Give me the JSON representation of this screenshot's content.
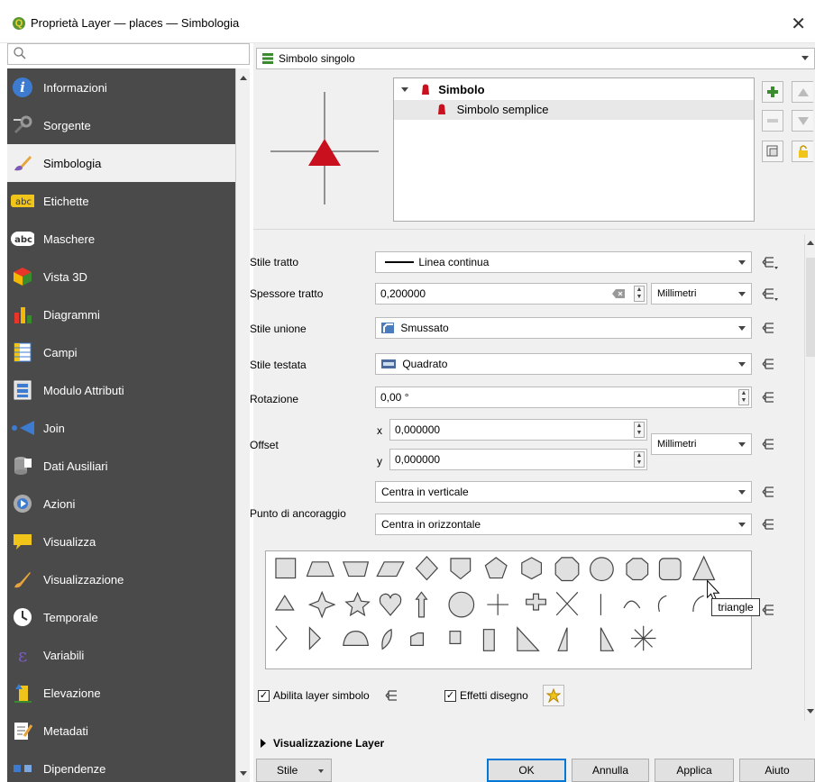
{
  "window": {
    "title": "Proprietà Layer — places — Simbologia",
    "app_icon_letter": "Q"
  },
  "search": {
    "placeholder": ""
  },
  "sidebar": {
    "items": [
      {
        "label": "Informazioni",
        "icon": "info-icon"
      },
      {
        "label": "Sorgente",
        "icon": "source-icon"
      },
      {
        "label": "Simbologia",
        "icon": "paintbrush-icon",
        "active": true
      },
      {
        "label": "Etichette",
        "icon": "labels-icon"
      },
      {
        "label": "Maschere",
        "icon": "masks-icon"
      },
      {
        "label": "Vista 3D",
        "icon": "cube-icon"
      },
      {
        "label": "Diagrammi",
        "icon": "diagram-icon"
      },
      {
        "label": "Campi",
        "icon": "fields-icon"
      },
      {
        "label": "Modulo Attributi",
        "icon": "form-icon"
      },
      {
        "label": "Join",
        "icon": "join-icon"
      },
      {
        "label": "Dati Ausiliari",
        "icon": "database-icon"
      },
      {
        "label": "Azioni",
        "icon": "actions-icon"
      },
      {
        "label": "Visualizza",
        "icon": "speech-bubble-icon"
      },
      {
        "label": "Visualizzazione",
        "icon": "brush-icon"
      },
      {
        "label": "Temporale",
        "icon": "clock-icon"
      },
      {
        "label": "Variabili",
        "icon": "epsilon-icon"
      },
      {
        "label": "Elevazione",
        "icon": "elevation-icon"
      },
      {
        "label": "Metadati",
        "icon": "metadata-icon"
      },
      {
        "label": "Dipendenze",
        "icon": "dependencies-icon"
      }
    ]
  },
  "renderer": {
    "selected": "Simbolo singolo"
  },
  "symbol_tree": {
    "root": "Simbolo",
    "child": "Simbolo semplice"
  },
  "props": {
    "stroke_style": {
      "label": "Stile tratto",
      "value": "Linea continua"
    },
    "stroke_width": {
      "label": "Spessore tratto",
      "value": "0,200000",
      "unit": "Millimetri"
    },
    "join_style": {
      "label": "Stile unione",
      "value": "Smussato"
    },
    "cap_style": {
      "label": "Stile testata",
      "value": "Quadrato"
    },
    "rotation": {
      "label": "Rotazione",
      "value": "0,00 °"
    },
    "offset": {
      "label": "Offset",
      "x_label": "x",
      "x": "0,000000",
      "y_label": "y",
      "y": "0,000000",
      "unit": "Millimetri"
    },
    "anchor": {
      "label": "Punto di ancoraggio",
      "vertical": "Centra in verticale",
      "horizontal": "Centra in orizzontale"
    }
  },
  "gallery": {
    "tooltip": "triangle"
  },
  "options": {
    "enable_symbol_layer": {
      "label": "Abilita layer simbolo",
      "checked": true
    },
    "draw_effects": {
      "label": "Effetti disegno",
      "checked": true
    }
  },
  "section": {
    "layer_rendering": "Visualizzazione Layer"
  },
  "buttons": {
    "style": "Stile",
    "ok": "OK",
    "cancel": "Annulla",
    "apply": "Applica",
    "help": "Aiuto"
  },
  "colors": {
    "sidebar_bg": "#4a4a4a",
    "marker_red": "#c8101e",
    "accent": "#0078d7"
  }
}
